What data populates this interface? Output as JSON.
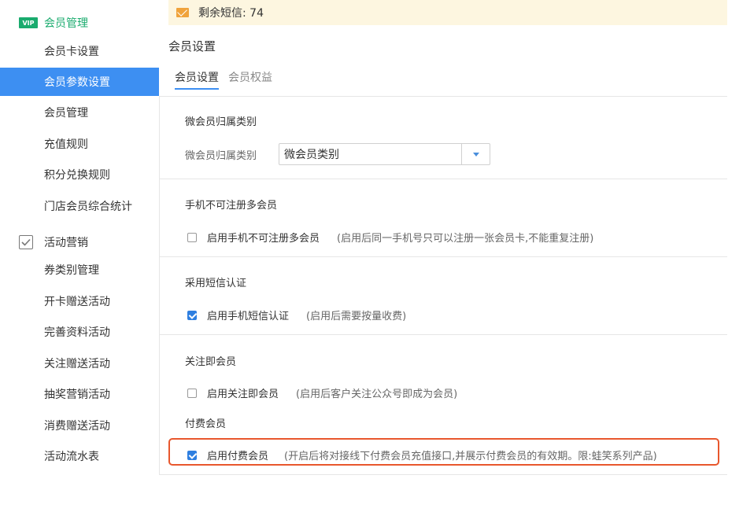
{
  "sidebar": {
    "groups": [
      {
        "icon": "vip-card-icon",
        "label": "会员管理",
        "items": [
          {
            "label": "会员卡设置"
          },
          {
            "label": "会员参数设置",
            "active": true
          },
          {
            "label": "会员管理"
          },
          {
            "label": "充值规则"
          },
          {
            "label": "积分兑换规则"
          },
          {
            "label": "门店会员综合统计"
          }
        ]
      },
      {
        "icon": "checkbox-icon",
        "label": "活动营销",
        "items": [
          {
            "label": "券类别管理"
          },
          {
            "label": "开卡赠送活动"
          },
          {
            "label": "完善资料活动"
          },
          {
            "label": "关注赠送活动"
          },
          {
            "label": "抽奖营销活动"
          },
          {
            "label": "消费赠送活动"
          },
          {
            "label": "活动流水表"
          }
        ]
      }
    ]
  },
  "sms": {
    "text": "剩余短信: 74",
    "icon": "mail-icon"
  },
  "page_title": "会员设置",
  "tabs": [
    {
      "label": "会员设置",
      "active": true
    },
    {
      "label": "会员权益",
      "active": false
    }
  ],
  "sections": {
    "category": {
      "title": "微会员归属类别",
      "field_label": "微会员归属类别",
      "select_value": "微会员类别"
    },
    "phone": {
      "title": "手机不可注册多会员",
      "option_label": "启用手机不可注册多会员",
      "hint": "(启用后同一手机号只可以注册一张会员卡,不能重复注册)",
      "checked": false
    },
    "sms_auth": {
      "title": "采用短信认证",
      "option_label": "启用手机短信认证",
      "hint": "(启用后需要按量收费)",
      "checked": true
    },
    "follow": {
      "title": "关注即会员",
      "option_label": "启用关注即会员",
      "hint": "(启用后客户关注公众号即成为会员)",
      "checked": false
    },
    "paid": {
      "title": "付费会员",
      "option_label": "启用付费会员",
      "hint": "(开启后将对接线下付费会员充值接口,并展示付费会员的有效期。限:蛙笑系列产品)",
      "checked": true
    }
  },
  "colors": {
    "accent": "#3d8ff2",
    "highlight": "#e8572d",
    "sms_bg": "#fdf6e0",
    "vip_green": "#1aab6e"
  }
}
